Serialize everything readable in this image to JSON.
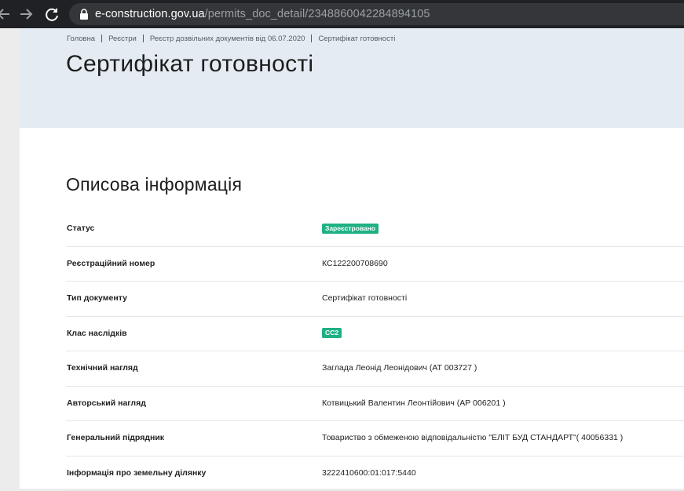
{
  "browser": {
    "url_host": "e-construction.gov.ua",
    "url_path": "/permits_doc_detail/2348860042284894105"
  },
  "breadcrumb": [
    "Головна",
    "Реєстри",
    "Реєстр дозвільних документів від 06.07.2020",
    "Сертифікат готовності"
  ],
  "page_title": "Сертифікат готовності",
  "section_title": "Описова інформація",
  "colors": {
    "hero_bg": "#e4ebf2",
    "badge_green": "#1fb084",
    "browser_bar": "#202124"
  },
  "rows": [
    {
      "label": "Статус",
      "value": "Зареєстровано",
      "badge": true
    },
    {
      "label": "Реєстраційний номер",
      "value": "КС122200708690",
      "badge": false
    },
    {
      "label": "Тип документу",
      "value": "Сертифікат готовності",
      "badge": false
    },
    {
      "label": "Клас наслідків",
      "value": "СС2",
      "badge": true
    },
    {
      "label": "Технічний нагляд",
      "value": "Заглада Леонід Леонідович (АТ 003727 )",
      "badge": false
    },
    {
      "label": "Авторський нагляд",
      "value": "Котвицький Валентин Леонтійович (АР 006201 )",
      "badge": false
    },
    {
      "label": "Генеральний підрядник",
      "value": "Товариство з обмеженою відповідальністю \"ЕЛІТ БУД СТАНДАРТ\"( 40056331 )",
      "badge": false
    },
    {
      "label": "Інформація про земельну ділянку",
      "value": "3222410600:01:017:5440",
      "badge": false
    }
  ],
  "icons": {
    "back": "back-arrow-icon",
    "forward": "forward-arrow-icon",
    "reload": "reload-icon",
    "lock": "lock-icon"
  }
}
